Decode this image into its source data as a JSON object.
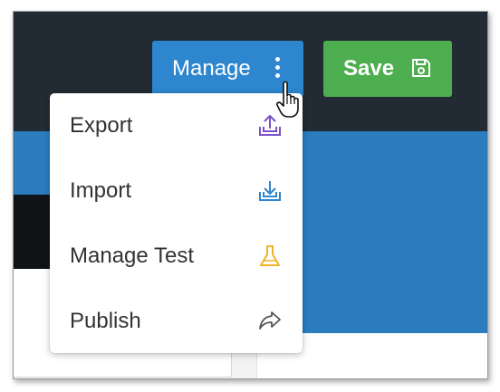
{
  "header": {
    "manage_button_label": "Manage",
    "save_button_label": "Save"
  },
  "dropdown_menu": {
    "items": [
      {
        "label": "Export",
        "icon": "export-upload-icon",
        "icon_color": "#7b4fc9"
      },
      {
        "label": "Import",
        "icon": "import-download-icon",
        "icon_color": "#2e86cf"
      },
      {
        "label": "Manage Test",
        "icon": "flask-icon",
        "icon_color": "#f0b429"
      },
      {
        "label": "Publish",
        "icon": "share-arrow-icon",
        "icon_color": "#555555"
      }
    ]
  },
  "colors": {
    "topbar": "#222a33",
    "manage_button": "#2e86cf",
    "save_button": "#4cae4f",
    "blue_band": "#2b7cbf"
  }
}
